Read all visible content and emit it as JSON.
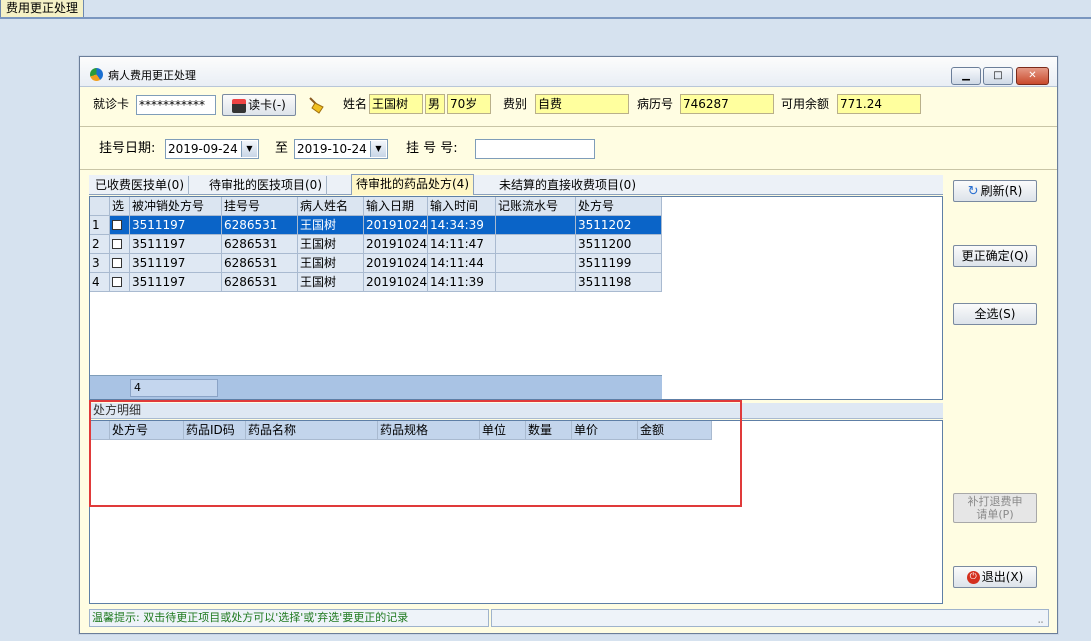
{
  "top_tab": {
    "label": "费用更正处理"
  },
  "window": {
    "title": "病人费用更正处理"
  },
  "patient": {
    "card_label": "就诊卡",
    "card_value": "***********",
    "read_card_label": "读卡(-)",
    "name_label": "姓名",
    "name_value": "王国树",
    "gender_value": "男",
    "age_value": "70岁",
    "fee_type_label": "费别",
    "fee_type_value": "自费",
    "record_no_label": "病历号",
    "record_no_value": "746287",
    "balance_label": "可用余额",
    "balance_value": "771.24"
  },
  "filter": {
    "reg_date_label": "挂号日期:",
    "date_from": "2019-09-24",
    "to_label": "至",
    "date_to": "2019-10-24",
    "reg_no_label": "挂 号 号:",
    "reg_no_value": ""
  },
  "tabs": [
    {
      "label": "已收费医技单(0)"
    },
    {
      "label": "待审批的医技项目(0)"
    },
    {
      "label": "待审批的药品处方(4)"
    },
    {
      "label": "未结算的直接收费项目(0)"
    }
  ],
  "grid": {
    "columns": [
      "选",
      "被冲销处方号",
      "挂号号",
      "病人姓名",
      "输入日期",
      "输入时间",
      "记账流水号",
      "处方号"
    ],
    "rows": [
      {
        "num": "1",
        "orig_rx": "3511197",
        "reg_no": "6286531",
        "name": "王国树",
        "date": "20191024",
        "time": "14:34:39",
        "serial": "",
        "rx": "3511202"
      },
      {
        "num": "2",
        "orig_rx": "3511197",
        "reg_no": "6286531",
        "name": "王国树",
        "date": "20191024",
        "time": "14:11:47",
        "serial": "",
        "rx": "3511200"
      },
      {
        "num": "3",
        "orig_rx": "3511197",
        "reg_no": "6286531",
        "name": "王国树",
        "date": "20191024",
        "time": "14:11:44",
        "serial": "",
        "rx": "3511199"
      },
      {
        "num": "4",
        "orig_rx": "3511197",
        "reg_no": "6286531",
        "name": "王国树",
        "date": "20191024",
        "time": "14:11:39",
        "serial": "",
        "rx": "3511198"
      }
    ],
    "footer_count": "4"
  },
  "detail": {
    "title": "处方明细",
    "columns": [
      "处方号",
      "药品ID码",
      "药品名称",
      "药品规格",
      "单位",
      "数量",
      "单价",
      "金额"
    ]
  },
  "actions": {
    "refresh": "刷新(R)",
    "confirm": "更正确定(Q)",
    "select_all": "全选(S)",
    "reprint_line1": "补打退费申",
    "reprint_line2": "请单(P)",
    "exit": "退出(X)"
  },
  "status": {
    "hint": "温馨提示: 双击待更正项目或处方可以'选择'或'弃选'要更正的记录"
  },
  "colors": {
    "selection": "#0a64c8",
    "highlight_field": "#ffff9e",
    "annotation": "#e03a3a",
    "hint_text": "#1f7a1f"
  }
}
